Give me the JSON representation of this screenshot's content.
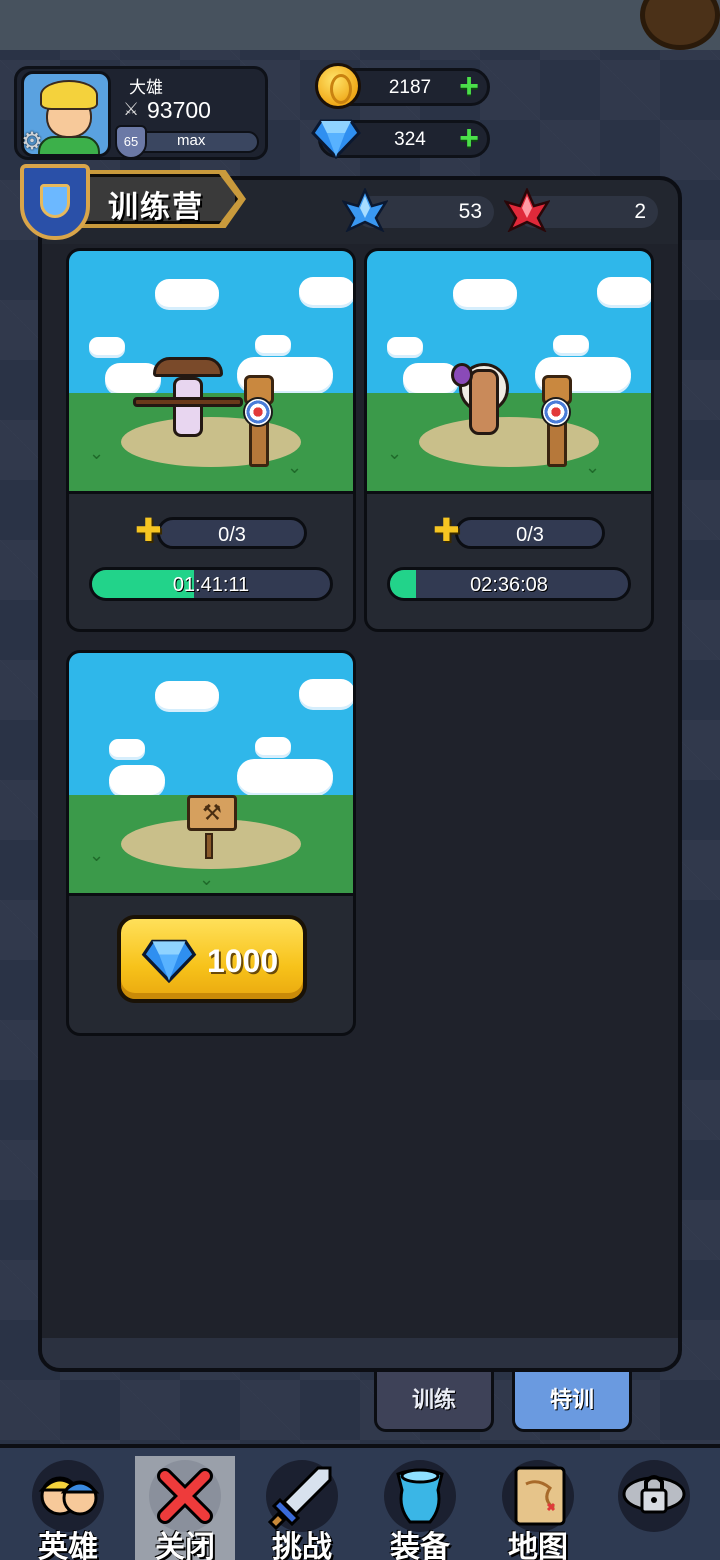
{
  "player": {
    "name": "大雄",
    "power": "93700",
    "level": "65",
    "level_status": "max"
  },
  "currencies": {
    "gold": "2187",
    "gems": "324"
  },
  "panel": {
    "title": "训练营",
    "blue_crystals": "53",
    "red_crystals": "2"
  },
  "slots": [
    {
      "fragments": "0/3",
      "timer": "01:41:11",
      "progress": 0.43
    },
    {
      "fragments": "0/3",
      "timer": "02:36:08",
      "progress": 0.11
    }
  ],
  "locked_slot": {
    "price": "1000"
  },
  "tabs": {
    "train": "训练",
    "special": "特训"
  },
  "nav": {
    "heroes": "英雄",
    "close": "关闭",
    "challenge": "挑战",
    "equipment": "装备",
    "map": "地图"
  },
  "colors": {
    "progress_fill": "#22d38a",
    "active_tab": "#6a9ae0",
    "plus_button": "#4be04a"
  }
}
